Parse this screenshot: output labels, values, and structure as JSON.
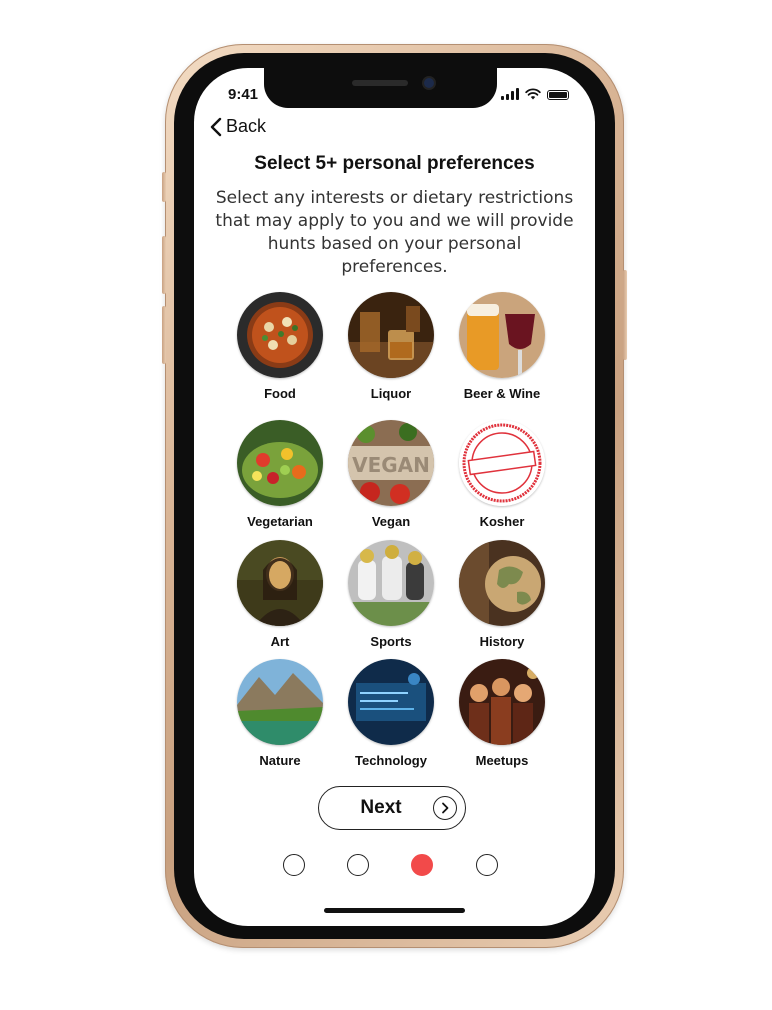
{
  "status": {
    "time": "9:41"
  },
  "nav": {
    "back_label": "Back"
  },
  "title": "Select 5+ personal preferences",
  "description": "Select any interests or dietary restrictions that may apply to you and we will provide hunts based on your personal preferences.",
  "preferences": [
    {
      "label": "Food"
    },
    {
      "label": "Liquor"
    },
    {
      "label": "Beer & Wine"
    },
    {
      "label": "Vegetarian"
    },
    {
      "label": "Vegan"
    },
    {
      "label": "Kosher"
    },
    {
      "label": "Art"
    },
    {
      "label": "Sports"
    },
    {
      "label": "History"
    },
    {
      "label": "Nature"
    },
    {
      "label": "Technology"
    },
    {
      "label": "Meetups"
    }
  ],
  "next_button": {
    "label": "Next"
  },
  "pagination": {
    "total": 4,
    "active_index": 2
  },
  "colors": {
    "accent": "#f24a4a",
    "frame": "#d9b596"
  }
}
